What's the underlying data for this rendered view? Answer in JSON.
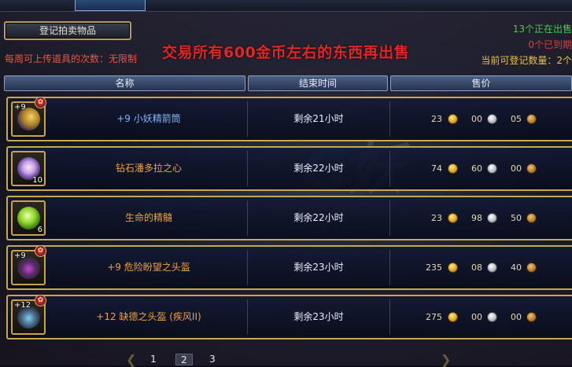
{
  "header": {
    "register_button": "登记拍卖物品",
    "weekly_limit": "每周可上传道具的次数：无限制",
    "banner": "交易所有600金币左右的东西再出售",
    "selling_status": "13个正在出售",
    "expired_status": "0个已到期",
    "available_status": "当前可登记数量：2个"
  },
  "columns": {
    "name": "名称",
    "end_time": "结束时间",
    "price": "售价"
  },
  "watermark": "G妖",
  "rows": [
    {
      "enhance": "+9",
      "stack": "",
      "sealed": true,
      "name": "+9 小妖精箭筒",
      "name_color": "#7fb2ff",
      "end_time": "剩余21小时",
      "gold": "23",
      "silver": "00",
      "copper": "05",
      "art": "quiver-icon"
    },
    {
      "enhance": "",
      "stack": "10",
      "sealed": false,
      "name": "钻石潘多拉之心",
      "name_color": "#f0a23c",
      "end_time": "剩余22小时",
      "gold": "74",
      "silver": "60",
      "copper": "00",
      "art": "diamond-heart-icon"
    },
    {
      "enhance": "",
      "stack": "6",
      "sealed": false,
      "name": "生命的精髓",
      "name_color": "#f0a23c",
      "end_time": "剩余22小时",
      "gold": "23",
      "silver": "98",
      "copper": "50",
      "art": "life-essence-icon"
    },
    {
      "enhance": "+9",
      "stack": "",
      "sealed": true,
      "name": "+9 危险盼望之头盔",
      "name_color": "#f0a23c",
      "end_time": "剩余23小时",
      "gold": "235",
      "silver": "08",
      "copper": "40",
      "art": "helmet-icon"
    },
    {
      "enhance": "+12",
      "stack": "",
      "sealed": true,
      "name": "+12 缺德之头盔 (疾风II)",
      "name_color": "#f0a23c",
      "end_time": "剩余23小时",
      "gold": "275",
      "silver": "00",
      "copper": "00",
      "art": "helmet-icon"
    }
  ],
  "pagination": {
    "pages": [
      "1",
      "2",
      "3"
    ],
    "current": "2"
  }
}
